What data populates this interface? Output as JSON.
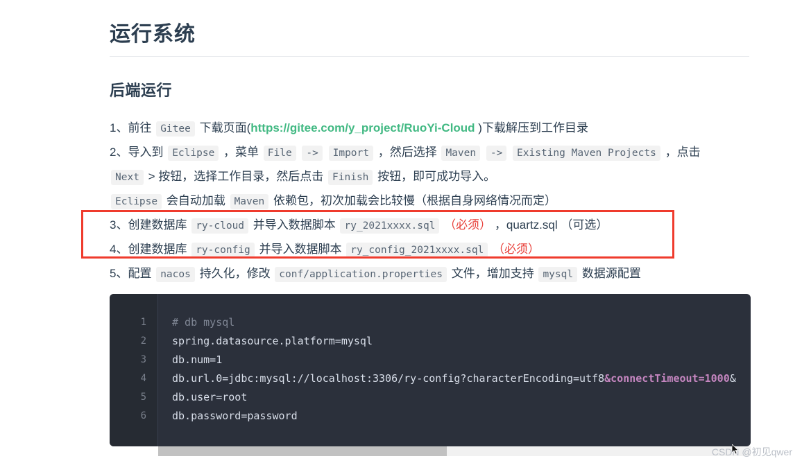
{
  "page": {
    "title": "运行系统",
    "subtitle": "后端运行"
  },
  "steps": [
    {
      "id": "step-1",
      "parts": [
        {
          "t": "text",
          "v": "1、前往 "
        },
        {
          "t": "code",
          "v": "Gitee"
        },
        {
          "t": "text",
          "v": " 下载页面("
        },
        {
          "t": "link",
          "v": "https://gitee.com/y_project/RuoYi-Cloud"
        },
        {
          "t": "text",
          "v": " )下载解压到工作目录"
        }
      ]
    },
    {
      "id": "step-2-line-1",
      "parts": [
        {
          "t": "text",
          "v": "2、导入到 "
        },
        {
          "t": "code",
          "v": "Eclipse"
        },
        {
          "t": "text",
          "v": " ，菜单 "
        },
        {
          "t": "code",
          "v": "File"
        },
        {
          "t": "text",
          "v": " "
        },
        {
          "t": "code",
          "v": "->"
        },
        {
          "t": "text",
          "v": " "
        },
        {
          "t": "code",
          "v": "Import"
        },
        {
          "t": "text",
          "v": " ，然后选择 "
        },
        {
          "t": "code",
          "v": "Maven"
        },
        {
          "t": "text",
          "v": " "
        },
        {
          "t": "code",
          "v": "->"
        },
        {
          "t": "text",
          "v": " "
        },
        {
          "t": "code",
          "v": "Existing Maven Projects"
        },
        {
          "t": "text",
          "v": " ，点击"
        }
      ]
    },
    {
      "id": "step-2-line-2",
      "parts": [
        {
          "t": "code",
          "v": "Next"
        },
        {
          "t": "text",
          "v": " > 按钮，选择工作目录，然后点击 "
        },
        {
          "t": "code",
          "v": "Finish"
        },
        {
          "t": "text",
          "v": " 按钮，即可成功导入。"
        }
      ]
    },
    {
      "id": "step-2-line-3",
      "parts": [
        {
          "t": "code",
          "v": "Eclipse"
        },
        {
          "t": "text",
          "v": " 会自动加载 "
        },
        {
          "t": "code",
          "v": "Maven"
        },
        {
          "t": "text",
          "v": " 依赖包，初次加载会比较慢（根据自身网络情况而定）"
        }
      ]
    },
    {
      "id": "step-3",
      "parts": [
        {
          "t": "text",
          "v": "3、创建数据库 "
        },
        {
          "t": "code",
          "v": "ry-cloud"
        },
        {
          "t": "text",
          "v": " 并导入数据脚本 "
        },
        {
          "t": "code",
          "v": "ry_2021xxxx.sql"
        },
        {
          "t": "text",
          "v": " "
        },
        {
          "t": "required",
          "v": "（必须）"
        },
        {
          "t": "text",
          "v": " ，quartz.sql "
        },
        {
          "t": "optional",
          "v": "（可选）"
        }
      ]
    },
    {
      "id": "step-4",
      "parts": [
        {
          "t": "text",
          "v": "4、创建数据库 "
        },
        {
          "t": "code",
          "v": "ry-config"
        },
        {
          "t": "text",
          "v": " 并导入数据脚本 "
        },
        {
          "t": "code",
          "v": "ry_config_2021xxxx.sql"
        },
        {
          "t": "text",
          "v": " "
        },
        {
          "t": "required",
          "v": "（必须）"
        }
      ]
    },
    {
      "id": "step-5",
      "parts": [
        {
          "t": "text",
          "v": "5、配置 "
        },
        {
          "t": "code",
          "v": "nacos"
        },
        {
          "t": "text",
          "v": " 持久化，修改 "
        },
        {
          "t": "code",
          "v": "conf/application.properties"
        },
        {
          "t": "text",
          "v": " 文件，增加支持 "
        },
        {
          "t": "code",
          "v": "mysql"
        },
        {
          "t": "text",
          "v": " 数据源配置"
        }
      ]
    }
  ],
  "code_block": {
    "language": "properties",
    "line_numbers": [
      "1",
      "2",
      "3",
      "4",
      "5",
      "6"
    ],
    "lines": [
      [
        {
          "t": "comment",
          "v": "# db mysql"
        }
      ],
      [
        {
          "t": "plain",
          "v": "spring.datasource.platform=mysql"
        }
      ],
      [
        {
          "t": "plain",
          "v": "db.num=1"
        }
      ],
      [
        {
          "t": "plain",
          "v": "db.url.0=jdbc:mysql://localhost:3306/ry-config?characterEncoding=utf8"
        },
        {
          "t": "entity",
          "v": "&connectTimeout=1000"
        },
        {
          "t": "plain",
          "v": "&"
        }
      ],
      [
        {
          "t": "plain",
          "v": "db.user=root"
        }
      ],
      [
        {
          "t": "plain",
          "v": "db.password=password"
        }
      ]
    ]
  },
  "watermark": "CSDN @初见qwer",
  "colors": {
    "heading": "#2c3e50",
    "link": "#42b983",
    "required": "#e8403a",
    "highlight_box": "#ef3b2d",
    "code_bg": "#2b303b",
    "code_entity": "#c586c0",
    "chip_bg": "#f2f2f2"
  }
}
